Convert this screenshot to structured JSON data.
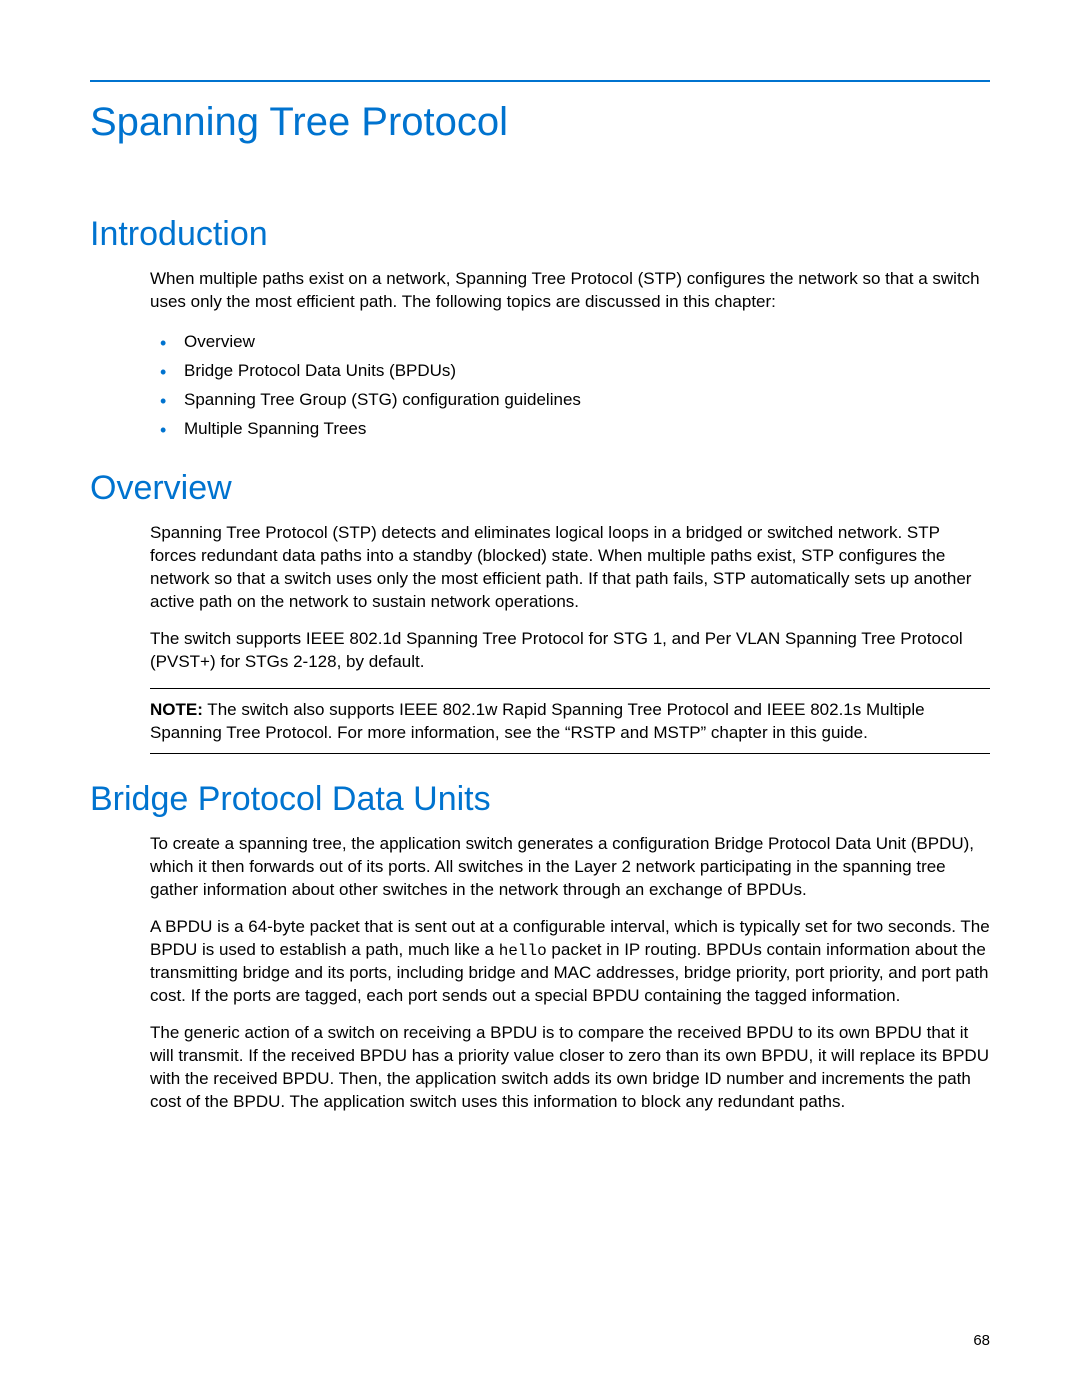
{
  "title": "Spanning Tree Protocol",
  "page_number": "68",
  "sections": {
    "introduction": {
      "heading": "Introduction",
      "para1": "When multiple paths exist on a network, Spanning Tree Protocol (STP) configures the network so that a switch uses only the most efficient path. The following topics are discussed in this chapter:",
      "bullets": [
        "Overview",
        "Bridge Protocol Data Units (BPDUs)",
        "Spanning Tree Group (STG) configuration guidelines",
        "Multiple Spanning Trees"
      ]
    },
    "overview": {
      "heading": "Overview",
      "para1": "Spanning Tree Protocol (STP) detects and eliminates logical loops in a bridged or switched network. STP forces redundant data paths into a standby (blocked) state. When multiple paths exist, STP configures the network so that a switch uses only the most efficient path. If that path fails, STP automatically sets up another active path on the network to sustain network operations.",
      "para2": "The switch supports IEEE 802.1d Spanning Tree Protocol for STG 1, and Per VLAN Spanning Tree Protocol (PVST+) for STGs 2-128, by default.",
      "note_label": "NOTE:",
      "note_text": " The switch also supports IEEE 802.1w Rapid Spanning Tree Protocol and IEEE 802.1s Multiple Spanning Tree Protocol. For more information, see the “RSTP and MSTP” chapter in this guide."
    },
    "bpdu": {
      "heading": "Bridge Protocol Data Units",
      "para1": "To create a spanning tree, the application switch generates a configuration Bridge Protocol Data Unit (BPDU), which it then forwards out of its ports. All switches in the Layer 2 network participating in the spanning tree gather information about other switches in the network through an exchange of BPDUs.",
      "para2_pre": "A BPDU is a 64-byte packet that is sent out at a configurable interval, which is typically set for two seconds. The BPDU is used to establish a path, much like a ",
      "para2_mono": "hello",
      "para2_post": " packet in IP routing. BPDUs contain information about the transmitting bridge and its ports, including bridge and MAC addresses, bridge priority, port priority, and port path cost. If the ports are tagged, each port sends out a special BPDU containing the tagged information.",
      "para3": "The generic action of a switch on receiving a BPDU is to compare the received BPDU to its own BPDU that it will transmit. If the received BPDU has a priority value closer to zero than its own BPDU, it will replace its BPDU with the received BPDU. Then, the application switch adds its own bridge ID number and increments the path cost of the BPDU. The application switch uses this information to block any redundant paths."
    }
  }
}
